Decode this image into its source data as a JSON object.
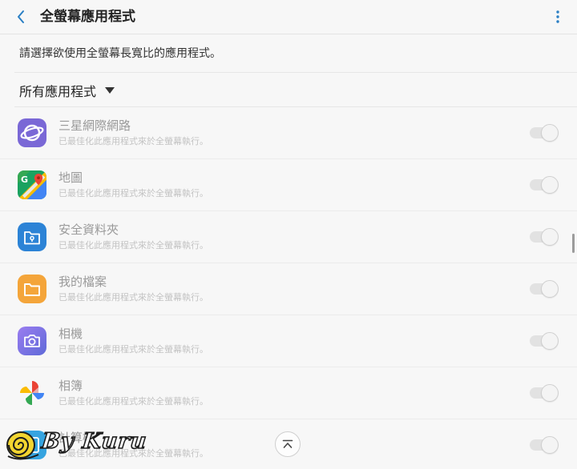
{
  "header": {
    "title": "全螢幕應用程式"
  },
  "description": "請選擇欲使用全螢幕長寬比的應用程式。",
  "filter": {
    "label": "所有應用程式"
  },
  "apps": [
    {
      "name": "三星網際網路",
      "subtitle": "已最佳化此應用程式來於全螢幕執行。",
      "icon": "samsung-internet-icon",
      "enabled": true
    },
    {
      "name": "地圖",
      "subtitle": "已最佳化此應用程式來於全螢幕執行。",
      "icon": "google-maps-icon",
      "enabled": true
    },
    {
      "name": "安全資料夾",
      "subtitle": "已最佳化此應用程式來於全螢幕執行。",
      "icon": "secure-folder-icon",
      "enabled": true
    },
    {
      "name": "我的檔案",
      "subtitle": "已最佳化此應用程式來於全螢幕執行。",
      "icon": "my-files-icon",
      "enabled": true
    },
    {
      "name": "相機",
      "subtitle": "已最佳化此應用程式來於全螢幕執行。",
      "icon": "camera-icon",
      "enabled": true
    },
    {
      "name": "相簿",
      "subtitle": "已最佳化此應用程式來於全螢幕執行。",
      "icon": "google-photos-icon",
      "enabled": true
    },
    {
      "name": "計算機",
      "subtitle": "已最佳化此應用程式來於全螢幕執行。",
      "icon": "calculator-icon",
      "enabled": true
    }
  ],
  "watermark": {
    "text": "By Kuru"
  },
  "colors": {
    "accent": "#2a7fc4",
    "text_primary": "#222222",
    "text_disabled": "#9a9a9a"
  }
}
